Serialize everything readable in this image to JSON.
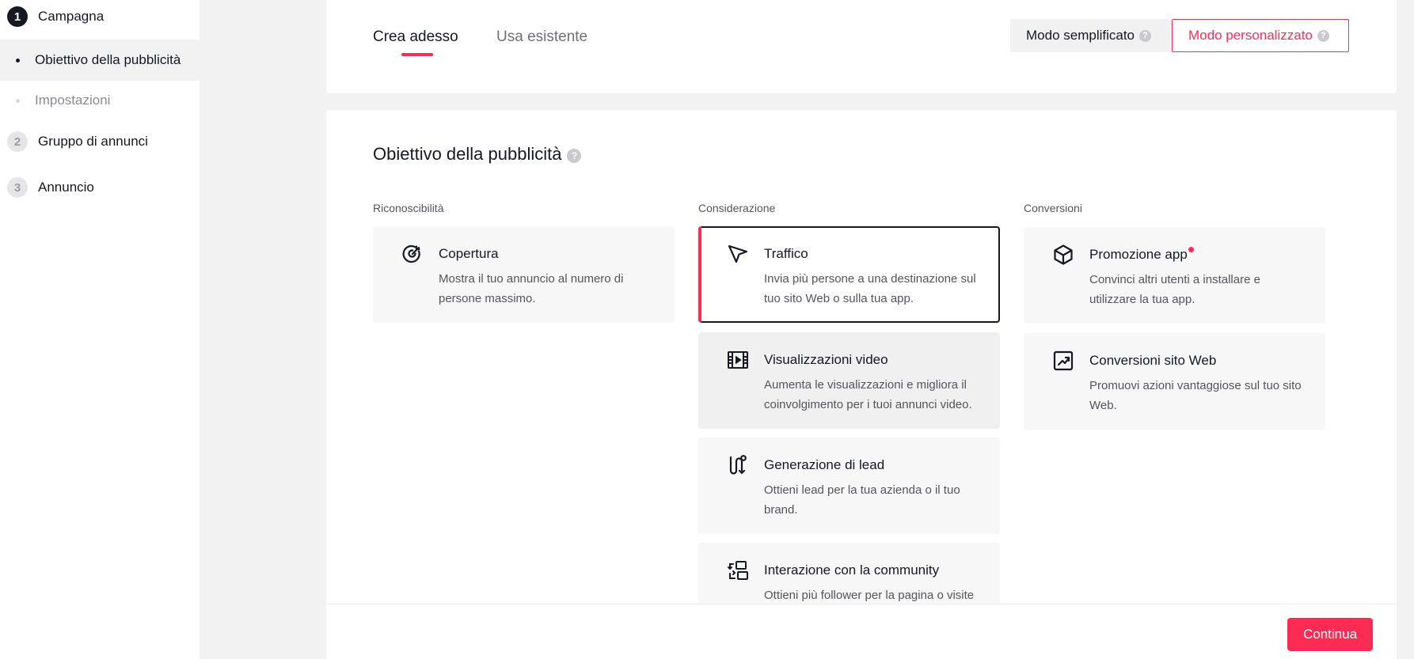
{
  "sidebar": {
    "steps": [
      {
        "num": "1",
        "label": "Campagna"
      },
      {
        "num": "2",
        "label": "Gruppo di annunci"
      },
      {
        "num": "3",
        "label": "Annuncio"
      }
    ],
    "substeps": [
      {
        "label": "Obiettivo della pubblicità"
      },
      {
        "label": "Impostazioni"
      }
    ]
  },
  "header": {
    "tabs": [
      {
        "label": "Crea adesso"
      },
      {
        "label": "Usa esistente"
      }
    ],
    "mode_simple": "Modo semplificato",
    "mode_custom": "Modo personalizzato",
    "help_glyph": "?"
  },
  "objective": {
    "title": "Obiettivo della pubblicità",
    "columns": [
      {
        "label": "Riconoscibilità",
        "cards": [
          {
            "title": "Copertura",
            "desc": "Mostra il tuo annuncio al numero di persone massimo.",
            "icon": "target-icon"
          }
        ]
      },
      {
        "label": "Considerazione",
        "cards": [
          {
            "title": "Traffico",
            "desc": "Invia più persone a una destinazione sul tuo sito Web o sulla tua app.",
            "icon": "cursor-arrow-icon"
          },
          {
            "title": "Visualizzazioni video",
            "desc": "Aumenta le visualizzazioni e migliora il coinvolgimento per i tuoi annunci video.",
            "icon": "film-icon"
          },
          {
            "title": "Generazione di lead",
            "desc": "Ottieni lead per la tua azienda o il tuo brand.",
            "icon": "funnel-path-icon"
          },
          {
            "title": "Interazione con la community",
            "desc": "Ottieni più follower per la pagina o visite",
            "icon": "community-swap-icon"
          }
        ]
      },
      {
        "label": "Conversioni",
        "cards": [
          {
            "title": "Promozione app",
            "desc": "Convinci altri utenti a installare e utilizzare la tua app.",
            "icon": "box-icon"
          },
          {
            "title": "Conversioni sito Web",
            "desc": "Promuovi azioni vantaggiose sul tuo sito Web.",
            "icon": "trend-chart-icon"
          }
        ]
      }
    ]
  },
  "footer": {
    "continue_label": "Continua"
  },
  "colors": {
    "accent": "#fe2c55",
    "text": "#161823"
  }
}
